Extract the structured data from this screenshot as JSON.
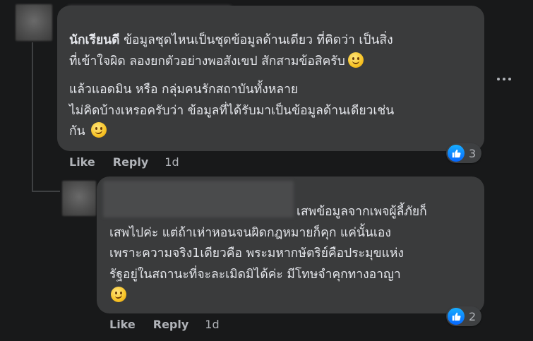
{
  "comment1": {
    "author": "นักเรียนดี",
    "para1": " ข้อมูลชุดไหนเป็นชุดข้อมูลด้านเดียว ที่คิดว่า เป็นสิ่ง\nที่เข้าใจผิด ลองยกตัวอย่างพอสังเขป สักสามข้อสิครับ",
    "para2": "แล้วแอดมิน หรือ กลุ่มคนรักสถาบันทั้งหลาย\nไม่คิดบ้างเหรอครับว่า ข้อมูลที่ได้รับมาเป็นข้อมูลด้านเดียวเช่น\nกัน",
    "emoji1": "slightly-smiling-face",
    "emoji2": "smirking-face",
    "reaction_count": "3",
    "like_label": "Like",
    "reply_label": "Reply",
    "time": "1d"
  },
  "comment2": {
    "line1": "เสพข้อมูลจากเพจผู้ลี้ภัยก็",
    "body": "เสพไปค่ะ แต่ถ้าเห่าหอนจนผิดกฎหมายก็คุก แค่นั้นเอง\nเพราะความจริง1เดียวคือ พระมหากษัตริย์คือประมุขแห่ง\nรัฐอยู่ในสถานะที่จะละเมิดมิได้ค่ะ มีโทษจำคุกทางอาญา",
    "emoji": "smirking-face",
    "reaction_count": "2",
    "like_label": "Like",
    "reply_label": "Reply",
    "time": "1d"
  },
  "colors": {
    "background": "#18191a",
    "bubble": "#3a3b3c",
    "text": "#e4e6eb",
    "secondary_text": "#b0b3b8",
    "like_blue": "#0566ff"
  }
}
